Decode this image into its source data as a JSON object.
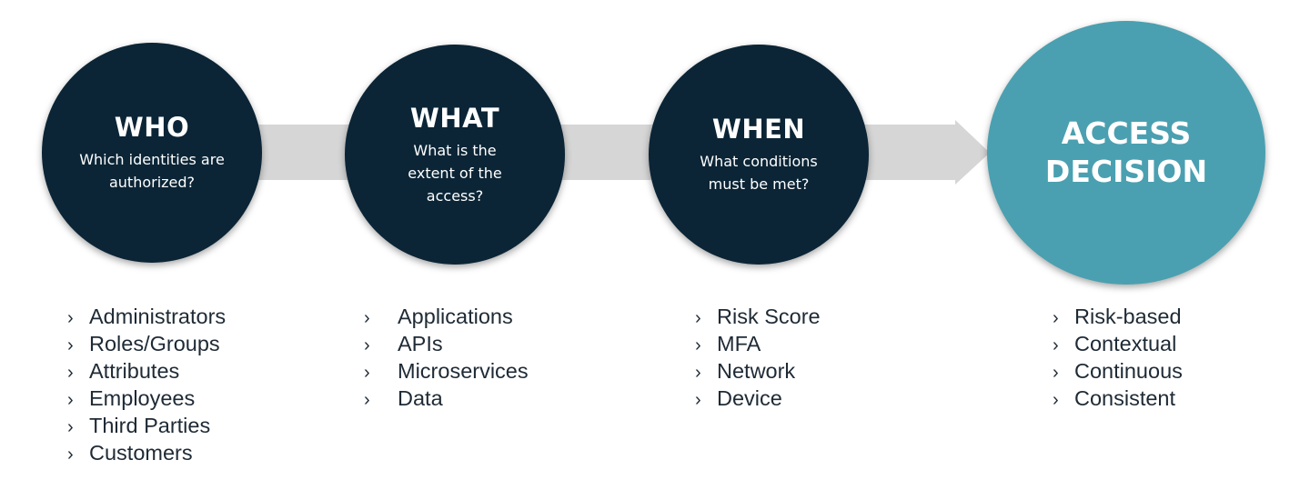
{
  "colors": {
    "dark": "#0b2536",
    "teal": "#4aa0b0",
    "arrow": "#d6d6d6",
    "text": "#1e2a35"
  },
  "bullet_icon": "chevron-right-icon",
  "stages": [
    {
      "title": "WHO",
      "subtitle": "Which identities are authorized?",
      "items": [
        "Administrators",
        "Roles/Groups",
        "Attributes",
        "Employees",
        "Third Parties",
        "Customers"
      ]
    },
    {
      "title": "WHAT",
      "subtitle": "What is the extent of the access?",
      "items": [
        "Applications",
        "APIs",
        "Microservices",
        "Data"
      ]
    },
    {
      "title": "WHEN",
      "subtitle": "What conditions must be met?",
      "items": [
        "Risk Score",
        "MFA",
        "Network",
        "Device"
      ]
    }
  ],
  "decision": {
    "title": "ACCESS DECISION",
    "items": [
      "Risk-based",
      "Contextual",
      "Continuous",
      "Consistent"
    ]
  }
}
